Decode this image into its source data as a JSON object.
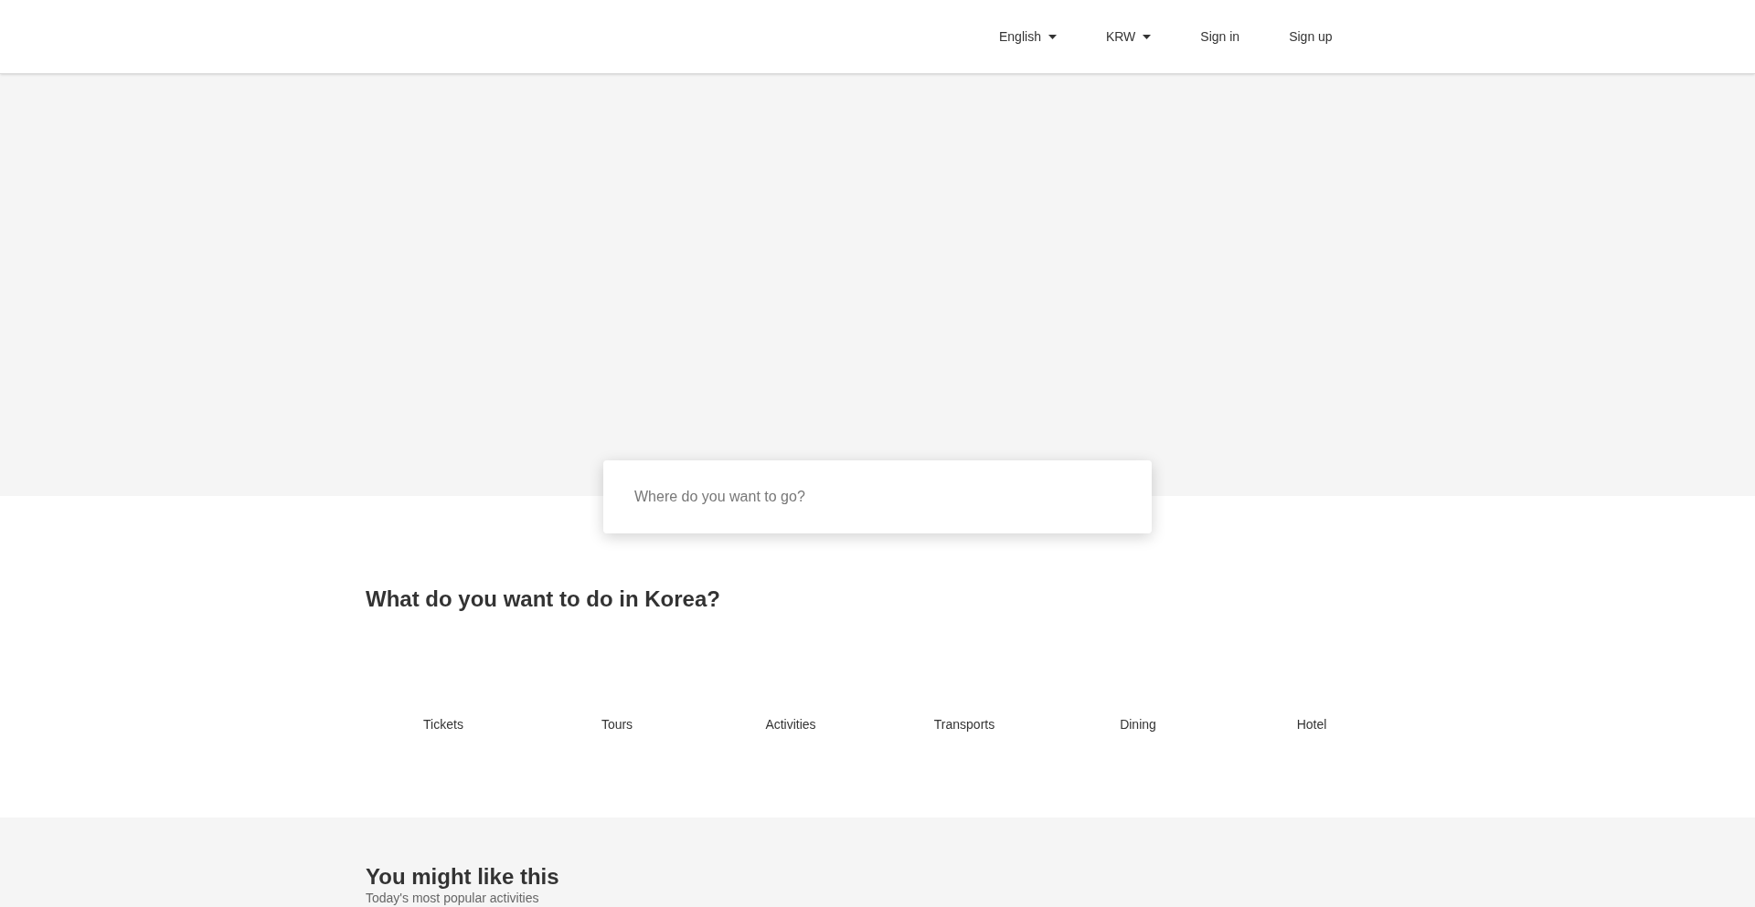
{
  "header": {
    "nav": [
      {
        "label": "English",
        "kind": "dropdown"
      },
      {
        "label": "KRW",
        "kind": "dropdown"
      },
      {
        "label": "Sign in",
        "kind": "link"
      },
      {
        "label": "Sign up",
        "kind": "link"
      }
    ]
  },
  "search": {
    "placeholder": "Where do you want to go?"
  },
  "categories": {
    "title": "What do you want to do in Korea?",
    "items": [
      "Tickets",
      "Tours",
      "Activities",
      "Transports",
      "Dining",
      "Hotel"
    ]
  },
  "recommendations": {
    "title": "You might like this",
    "subtitle": "Today's most popular activities"
  }
}
